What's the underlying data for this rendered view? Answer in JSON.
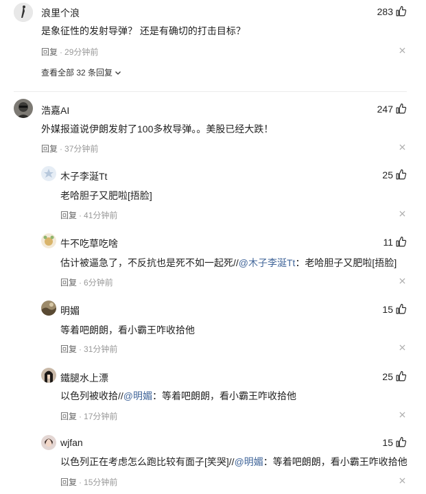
{
  "comments": [
    {
      "user": "浪里个浪",
      "likes": "283",
      "text": "是象征性的发射导弹？ 还是有确切的打击目标？",
      "reply_label": "回复",
      "time": "29分钟前",
      "view_all": "查看全部 32 条回复"
    },
    {
      "user": "浩嘉AI",
      "likes": "247",
      "text": "外媒报道说伊朗发射了100多枚导弹。。美股已经大跌！",
      "reply_label": "回复",
      "time": "37分钟前"
    }
  ],
  "replies": [
    {
      "user": "木子李涎Tt",
      "likes": "25",
      "text": "老哈胆子又肥啦[捂脸]",
      "reply_label": "回复",
      "time": "41分钟前"
    },
    {
      "user": "牛不吃草吃啥",
      "likes": "11",
      "text_pre": "估计被逼急了，不反抗也是死不如一起死//",
      "mention": "@木子李涎Tt",
      "text_post": "：老哈胆子又肥啦[捂脸]",
      "reply_label": "回复",
      "time": "6分钟前"
    },
    {
      "user": "明媚",
      "likes": "15",
      "text": "等着吧朗朗，看小霸王咋收拾他",
      "reply_label": "回复",
      "time": "31分钟前"
    },
    {
      "user": "鐵腿水上漂",
      "likes": "25",
      "text_pre": "以色列被收拾//",
      "mention": "@明媚",
      "text_post": "：等着吧朗朗，看小霸王咋收拾他",
      "reply_label": "回复",
      "time": "17分钟前"
    },
    {
      "user": "wjfan",
      "likes": "15",
      "text_pre": "以色列正在考虑怎么跑比较有面子[笑哭]//",
      "mention": "@明媚",
      "text_post": "：等着吧朗朗，看小霸王咋收拾他",
      "reply_label": "回复",
      "time": "15分钟前"
    }
  ],
  "icons": {
    "like": "thumbs-up-icon",
    "close": "close-icon",
    "chevron": "chevron-down-icon"
  },
  "colors": {
    "mention": "#406599",
    "meta": "#999999"
  }
}
